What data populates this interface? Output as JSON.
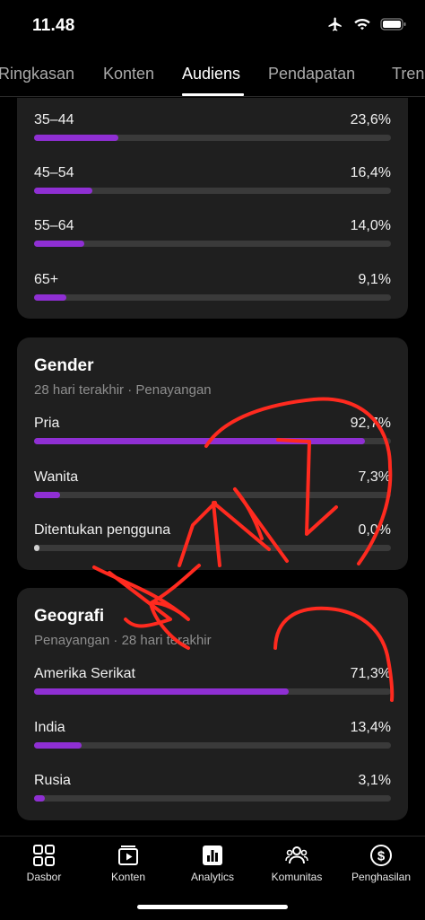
{
  "status": {
    "time": "11.48"
  },
  "tabs": [
    {
      "label": "Ringkasan",
      "active": false
    },
    {
      "label": "Konten",
      "active": false
    },
    {
      "label": "Audiens",
      "active": true
    },
    {
      "label": "Pendapatan",
      "active": false
    },
    {
      "label": "Tren",
      "active": false
    }
  ],
  "age": {
    "rows": [
      {
        "label": "35–44",
        "value": "23,6%",
        "percent": 23.6
      },
      {
        "label": "45–54",
        "value": "16,4%",
        "percent": 16.4
      },
      {
        "label": "55–64",
        "value": "14,0%",
        "percent": 14.0
      },
      {
        "label": "65+",
        "value": "9,1%",
        "percent": 9.1
      }
    ]
  },
  "gender": {
    "title": "Gender",
    "subtitle": "28 hari terakhir · Penayangan",
    "rows": [
      {
        "label": "Pria",
        "value": "92,7%",
        "percent": 92.7
      },
      {
        "label": "Wanita",
        "value": "7,3%",
        "percent": 7.3
      },
      {
        "label": "Ditentukan pengguna",
        "value": "0,0%",
        "percent": 0.0
      }
    ]
  },
  "geo": {
    "title": "Geografi",
    "subtitle": "Penayangan · 28 hari terakhir",
    "rows": [
      {
        "label": "Amerika Serikat",
        "value": "71,3%",
        "percent": 71.3
      },
      {
        "label": "India",
        "value": "13,4%",
        "percent": 13.4
      },
      {
        "label": "Rusia",
        "value": "3,1%",
        "percent": 3.1
      }
    ]
  },
  "nav": [
    {
      "label": "Dasbor",
      "icon": "dashboard-icon"
    },
    {
      "label": "Konten",
      "icon": "content-icon"
    },
    {
      "label": "Analytics",
      "icon": "analytics-icon"
    },
    {
      "label": "Komunitas",
      "icon": "community-icon"
    },
    {
      "label": "Penghasilan",
      "icon": "earn-icon"
    }
  ],
  "colors": {
    "accent": "#8f2fd3",
    "background": "#000000",
    "card": "#1f1f1f",
    "track": "#3a3a3a",
    "scribble": "#ff2a1f"
  }
}
